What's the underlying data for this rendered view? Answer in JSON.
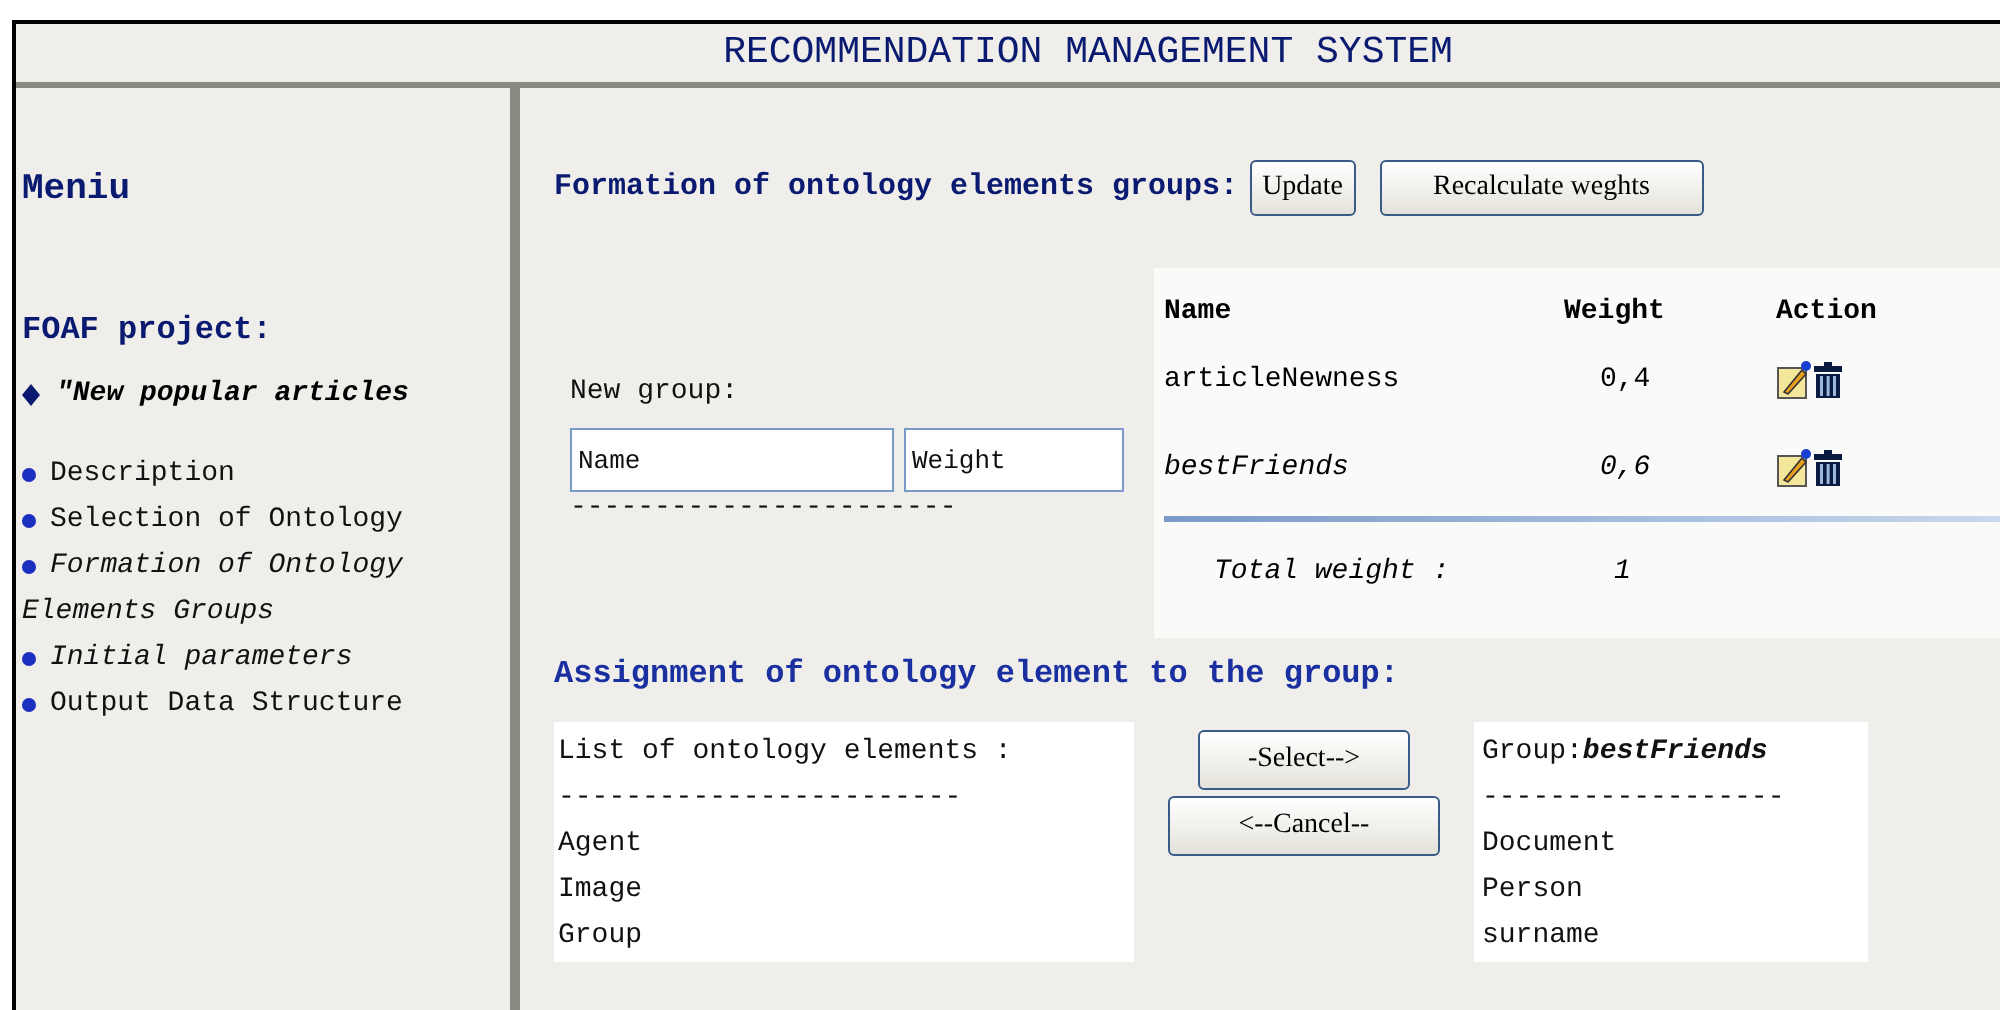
{
  "header": {
    "title": "RECOMMENDATION MANAGEMENT SYSTEM"
  },
  "sidebar": {
    "title": "Meniu",
    "project_title": "FOAF project:",
    "project_item": "\"New popular articles",
    "items": [
      {
        "label": "Description",
        "italic": false
      },
      {
        "label": "Selection of Ontology",
        "italic": false
      },
      {
        "label": "Formation of Ontology Elements Groups",
        "italic": true
      },
      {
        "label": "Initial parameters",
        "italic": true
      },
      {
        "label": "Output Data Structure",
        "italic": false
      }
    ]
  },
  "formation": {
    "title": "Formation of ontology elements groups:",
    "buttons": [
      "Update",
      "Recalculate weghts"
    ],
    "new_group": {
      "label": "New group:",
      "name_placeholder": "Name",
      "weight_placeholder": "Weight",
      "dashes": "-----------------------"
    },
    "table": {
      "columns": [
        "Name",
        "Weight",
        "Action"
      ],
      "rows": [
        {
          "name": "articleNewness",
          "weight": "0,4",
          "selected": false
        },
        {
          "name": "bestFriends",
          "weight": "0,6",
          "selected": true
        }
      ],
      "total_label": "Total weight :",
      "total_value": "1"
    }
  },
  "assignment": {
    "title": "Assignment of ontology element to the group:",
    "list_title": "List of ontology elements :",
    "list_dashes": "------------------------",
    "elements": [
      "Agent",
      "Image",
      "Group"
    ],
    "buttons": [
      "-Select-->",
      "<--Cancel--"
    ],
    "group_title": "Group:**bestFriends**",
    "group_dashes": "------------------",
    "group_elements": [
      "Document",
      "Person",
      "surname"
    ]
  }
}
